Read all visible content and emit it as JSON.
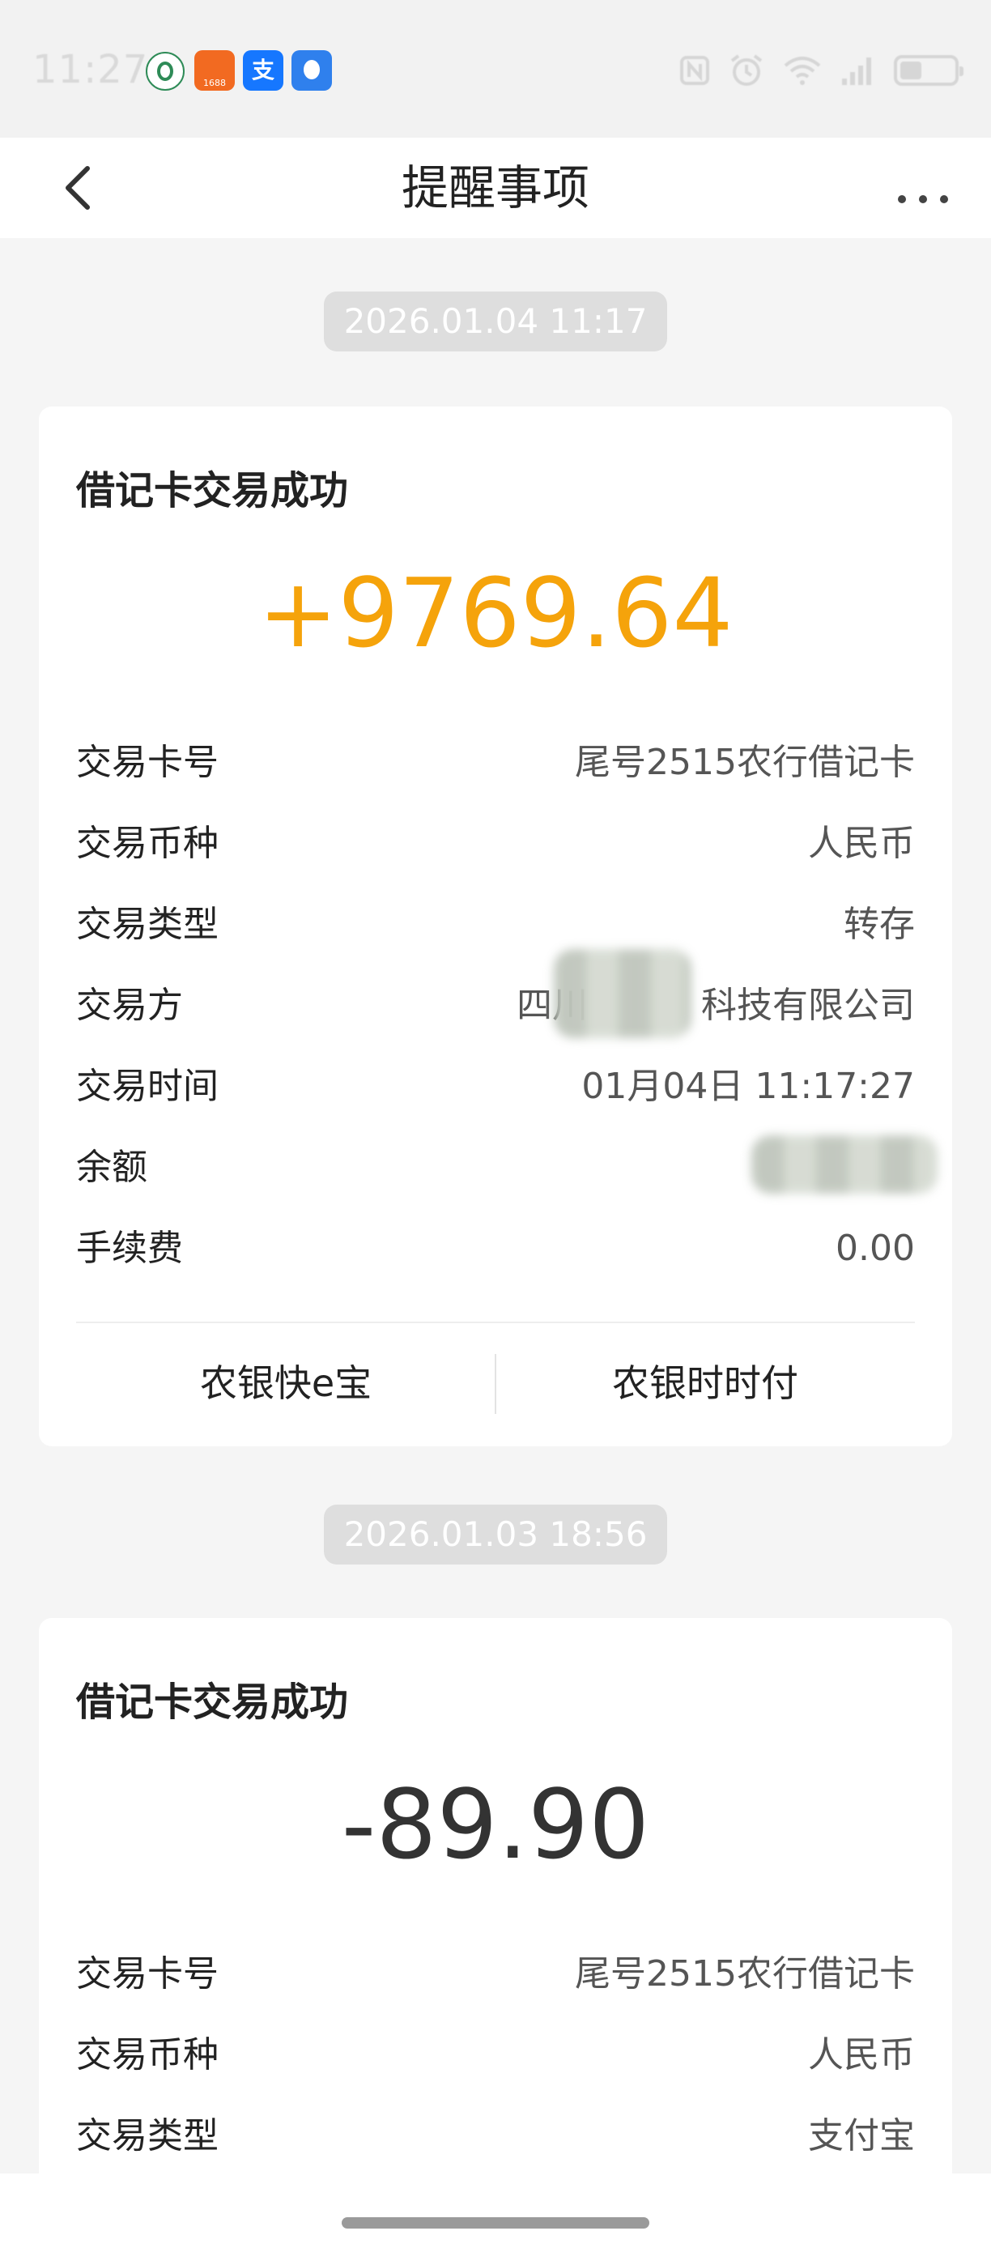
{
  "status_bar": {
    "time": "11:27",
    "apps": [
      "abc-bank-icon",
      "1688-icon",
      "alipay-icon",
      "upload-icon"
    ],
    "app_1688_label": "1688",
    "alipay_glyph": "支",
    "indicators": [
      "nfc-icon",
      "alarm-icon",
      "wifi-icon",
      "signal-icon",
      "battery-icon"
    ]
  },
  "header": {
    "title": "提醒事项",
    "back_icon": "chevron-left-icon",
    "more_icon": "more-dots-icon"
  },
  "notifications": [
    {
      "date": "2026.01.04 11:17",
      "title": "借记卡交易成功",
      "amount": "+9769.64",
      "amount_type": "credit",
      "rows": [
        {
          "label": "交易卡号",
          "value": "尾号2515农行借记卡"
        },
        {
          "label": "交易币种",
          "value": "人民币"
        },
        {
          "label": "交易类型",
          "value": "转存"
        },
        {
          "label": "交易方",
          "value": "四川          科技有限公司"
        },
        {
          "label": "交易时间",
          "value": "01月04日 11:17:27"
        },
        {
          "label": "余额",
          "value": ""
        },
        {
          "label": "手续费",
          "value": "0.00"
        }
      ],
      "actions": [
        "农银快e宝",
        "农银时时付"
      ]
    },
    {
      "date": "2026.01.03 18:56",
      "title": "借记卡交易成功",
      "amount": "-89.90",
      "amount_type": "debit",
      "rows": [
        {
          "label": "交易卡号",
          "value": "尾号2515农行借记卡"
        },
        {
          "label": "交易币种",
          "value": "人民币"
        },
        {
          "label": "交易类型",
          "value": "支付宝"
        }
      ]
    }
  ],
  "colors": {
    "credit": "#f5a30b",
    "debit": "#333333",
    "background": "#f5f5f5",
    "card": "#ffffff",
    "pill": "#dedede"
  }
}
